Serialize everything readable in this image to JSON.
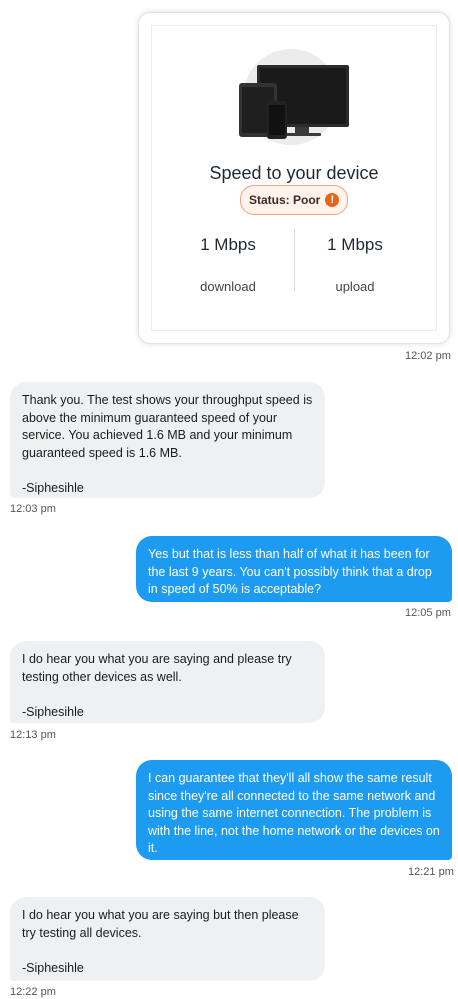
{
  "speed_card": {
    "title": "Speed to your device",
    "status_label": "Status: Poor",
    "status_icon": "!",
    "download_value": "1 Mbps",
    "download_label": "download",
    "upload_value": "1 Mbps",
    "upload_label": "upload",
    "status_color": "#e5661a",
    "icon": "devices-illustration"
  },
  "messages": [
    {
      "sender": "self",
      "text": "",
      "time": "12:02 pm"
    },
    {
      "sender": "agent",
      "text": "Thank you. The test shows your throughput speed is above the minimum guaranteed speed of your service. You achieved 1.6 MB and your minimum guaranteed speed is 1.6 MB.\n\n-Siphesihle",
      "time": "12:03 pm"
    },
    {
      "sender": "self",
      "text": "Yes but that is less than half of what it has been for the last 9 years. You can't possibly think that a drop in speed of 50% is acceptable?",
      "time": "12:05 pm"
    },
    {
      "sender": "agent",
      "text": "I do hear you what you are saying and please try testing other devices as well.\n\n-Siphesihle",
      "time": "12:13 pm"
    },
    {
      "sender": "self",
      "text": "I can guarantee that they'll all show the same result since they're all connected to the same network and using the same internet connection. The problem is with the line, not the home network or the devices on it.",
      "time": "12:21 pm"
    },
    {
      "sender": "agent",
      "text": "I do hear you what you are saying but then please try testing all devices.\n\n-Siphesihle",
      "time": "12:22 pm"
    }
  ],
  "colors": {
    "outgoing_bubble": "#1d9bf0",
    "incoming_bubble": "#eef0f2"
  }
}
